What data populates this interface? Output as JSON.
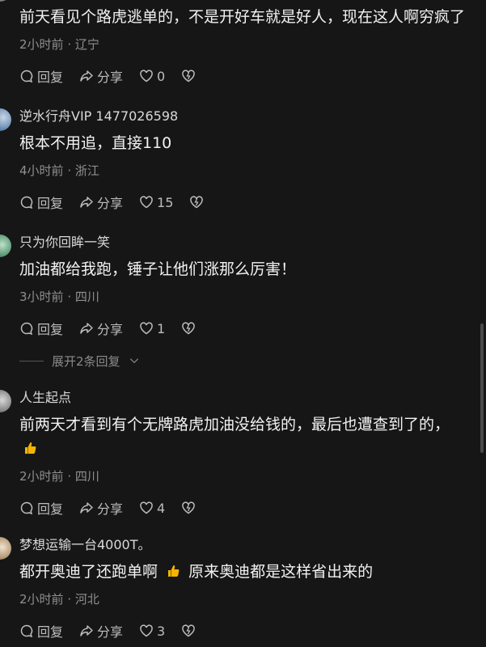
{
  "comments": [
    {
      "author": "",
      "text": "前天看见个路虎逃单的，不是开好车就是好人，现在这人啊穷疯了",
      "time": "2小时前",
      "location": "辽宁",
      "reply_label": "回复",
      "share_label": "分享",
      "likes": "0"
    },
    {
      "author": "逆水行舟VIP 1477026598",
      "text": "根本不用追，直接110",
      "time": "4小时前",
      "location": "浙江",
      "reply_label": "回复",
      "share_label": "分享",
      "likes": "15"
    },
    {
      "author": "只为你回眸一笑",
      "text": "加油都给我跑，锤子让他们涨那么厉害！",
      "time": "3小时前",
      "location": "四川",
      "reply_label": "回复",
      "share_label": "分享",
      "likes": "1",
      "expand_label": "展开2条回复"
    },
    {
      "author": "人生起点",
      "text": "前两天才看到有个无牌路虎加油没给钱的，最后也遭查到了的，",
      "time": "2小时前",
      "location": "四川",
      "reply_label": "回复",
      "share_label": "分享",
      "likes": "4"
    },
    {
      "author": "梦想运输一台4000T。",
      "text_a": "都开奥迪了还跑单啊",
      "text_b": "原来奥迪都是这样省出来的",
      "time": "2小时前",
      "location": "河北",
      "reply_label": "回复",
      "share_label": "分享",
      "likes": "3"
    }
  ],
  "separator": "·",
  "icons": [
    "reply-icon",
    "share-icon",
    "like-icon",
    "dislike-icon",
    "thumbs-up-emoji",
    "chevron-down-icon"
  ],
  "colors": {
    "background": "#161616",
    "text": "#f2f2f2",
    "meta": "#8f8f8f",
    "emoji": "#f5b400"
  }
}
